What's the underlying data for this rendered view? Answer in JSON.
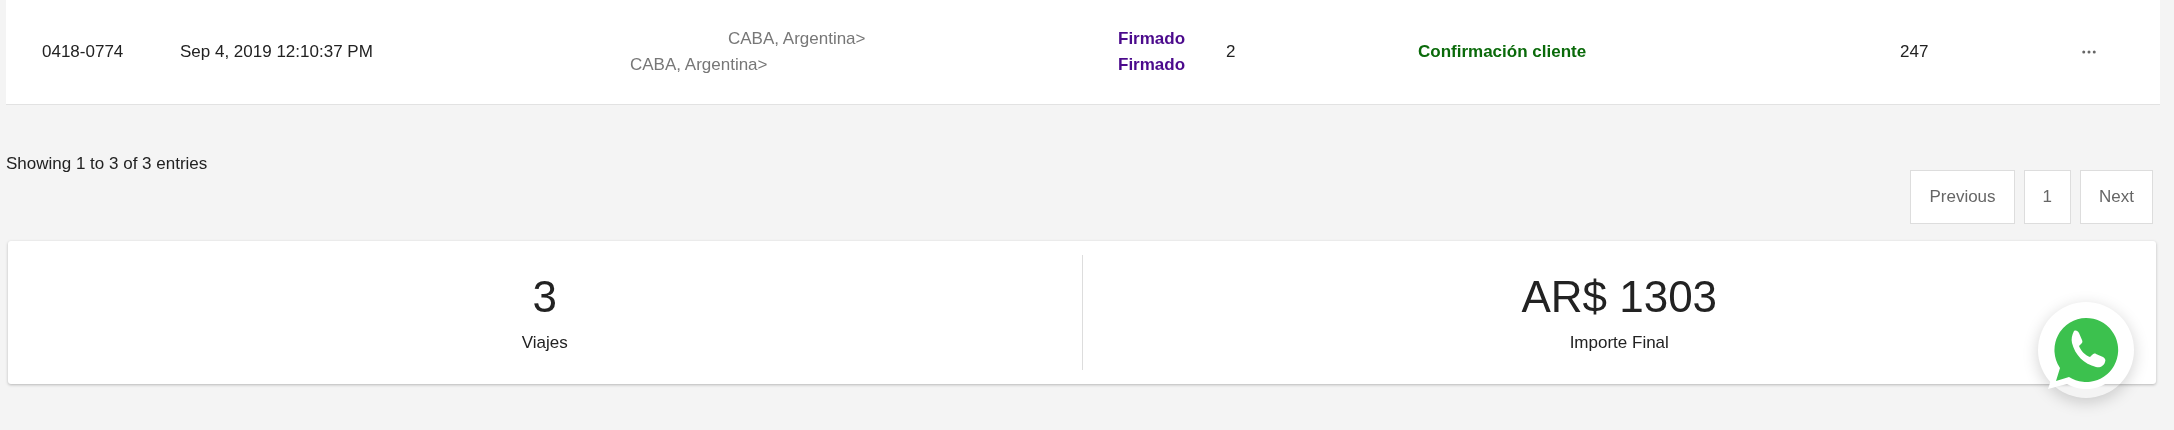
{
  "rows": [
    {
      "id": "0418-0774",
      "date": "Sep 4, 2019 12:10:37 PM",
      "origin": "CABA, Argentina>",
      "destination": "CABA, Argentina>",
      "signatures": [
        "Firmado",
        "Firmado"
      ],
      "count": "2",
      "status": "Confirmación cliente",
      "amount": "247"
    }
  ],
  "pagination": {
    "info": "Showing 1 to 3 of 3 entries",
    "buttons": [
      "Previous",
      "1",
      "Next"
    ]
  },
  "stats": [
    {
      "value": "3",
      "label": "Viajes"
    },
    {
      "value": "AR$ 1303",
      "label": "Importe Final"
    }
  ]
}
